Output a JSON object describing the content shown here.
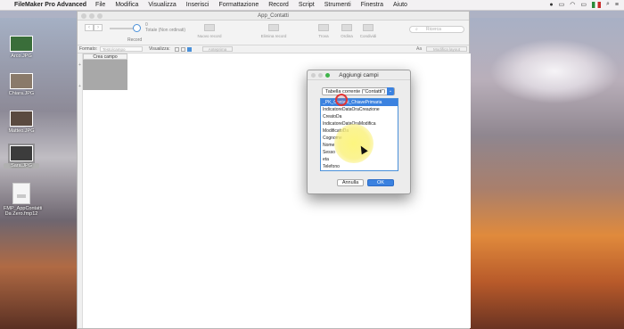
{
  "menubar": {
    "app_name": "FileMaker Pro Advanced",
    "items": [
      "File",
      "Modifica",
      "Visualizza",
      "Inserisci",
      "Formattazione",
      "Record",
      "Script",
      "Strumenti",
      "Finestra",
      "Aiuto"
    ]
  },
  "desktop": {
    "icons": [
      {
        "label": "Arco.JPG"
      },
      {
        "label": "Chiara.JPG"
      },
      {
        "label": "Matteo.JPG"
      },
      {
        "label": "Sara.JPG"
      },
      {
        "label": "FMP_AppContatti Da Zero.fmp12"
      }
    ]
  },
  "window": {
    "title": "App_Contatti",
    "toolbar": {
      "record_count": "0",
      "record_total": "Totale (Non ordinati)",
      "record_label": "Record",
      "tools": [
        "Nuovo record",
        "Elimina record",
        "Trova",
        "Ordina",
        "Condividi"
      ],
      "search_placeholder": "Ricerca"
    },
    "formatbar": {
      "format_label": "Formato:",
      "format_value": "Testo/campo",
      "visualizza_label": "Visualizza:",
      "anteprima": "Anteprima",
      "aa": "Aa",
      "modifica_layout": "Modifica layout"
    },
    "table": {
      "add_field_header": "Crea campo"
    }
  },
  "dialog": {
    "title": "Aggiungi campi",
    "table_select": "Tabella corrente (\"Contatti\")",
    "fields": [
      "_PK_Contatti_ChiavePrimaria",
      "IndicatoreDataOraCreazione",
      "CreatoDa",
      "IndicatoreDataOraModifica",
      "ModificatoDa",
      "Cognome",
      "Nome",
      "Sesso",
      "eta",
      "Telefono"
    ],
    "selected_index": 0,
    "cancel_label": "Annulla",
    "ok_label": "OK"
  }
}
